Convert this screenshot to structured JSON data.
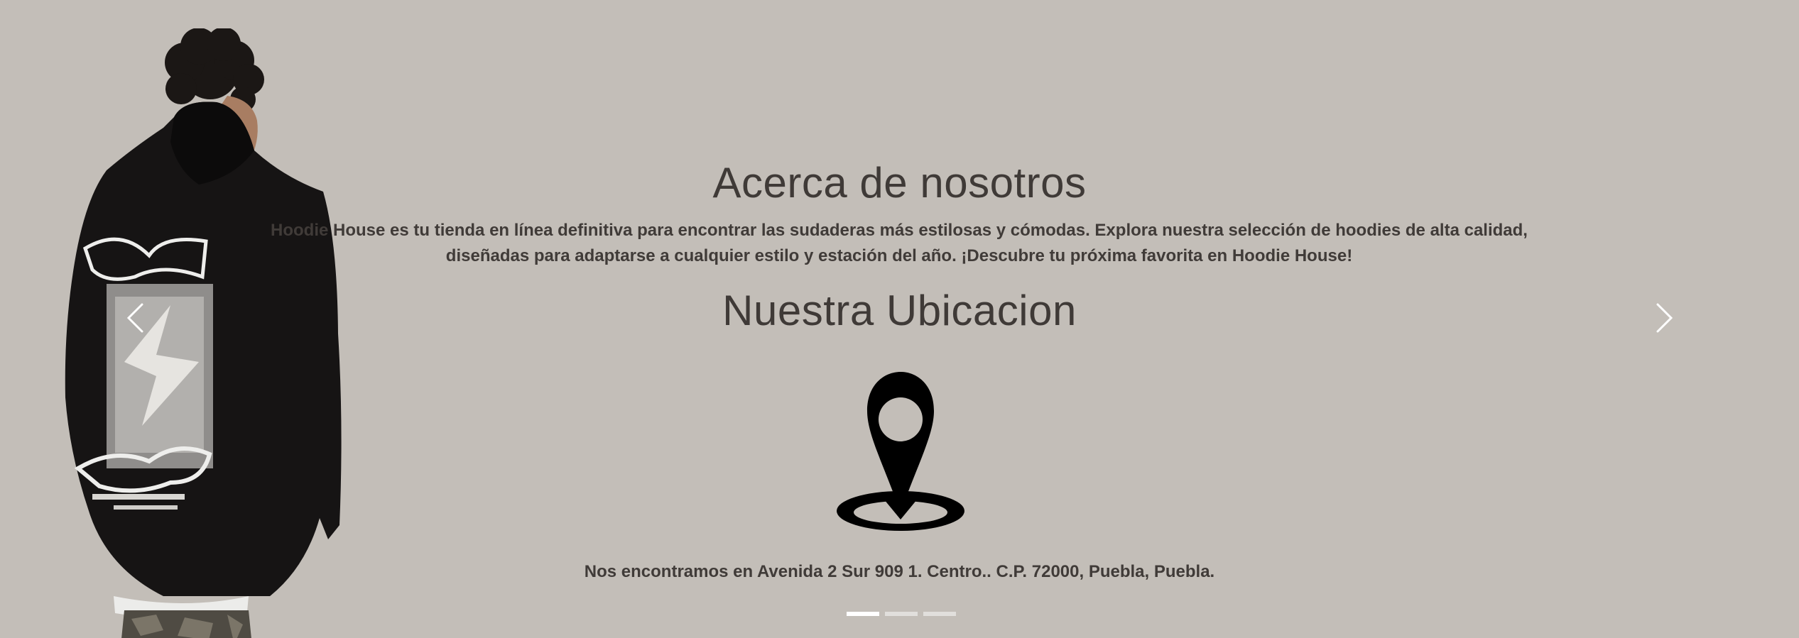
{
  "about": {
    "title": "Acerca de nosotros",
    "text": "Hoodie House es tu tienda en línea definitiva para encontrar las sudaderas más estilosas y cómodas. Explora nuestra selección de hoodies de alta calidad, diseñadas para adaptarse a cualquier estilo y estación del año. ¡Descubre tu próxima favorita en Hoodie House!"
  },
  "location": {
    "title": "Nuestra Ubicacion",
    "address": "Nos encontramos en Avenida 2 Sur 909 1. Centro.. C.P. 72000, Puebla, Puebla.",
    "icon": "map-pin-icon"
  },
  "carousel": {
    "prev_icon": "chevron-left-icon",
    "next_icon": "chevron-right-icon",
    "slide_count": 3,
    "active_slide": 1
  },
  "colors": {
    "background": "#c3beb8",
    "text": "#403b38",
    "indicator": "#ffffff"
  }
}
